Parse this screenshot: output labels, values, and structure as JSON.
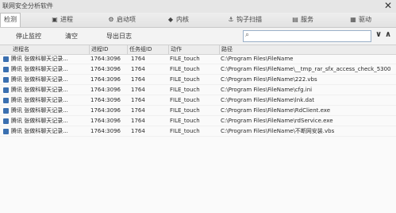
{
  "window": {
    "title": "联网安全分析软件",
    "close": "✕"
  },
  "tabs": [
    {
      "label": "检测",
      "icon": ""
    },
    {
      "label": "进程",
      "icon": "▣"
    },
    {
      "label": "启动项",
      "icon": "⚙"
    },
    {
      "label": "内核",
      "icon": "◆"
    },
    {
      "label": "钩子扫描",
      "icon": "⚓"
    },
    {
      "label": "服务",
      "icon": "▤"
    },
    {
      "label": "驱动",
      "icon": "▦"
    }
  ],
  "toolbar": {
    "stop": "停止监控",
    "clear": "清空",
    "export": "导出日志"
  },
  "search": {
    "value": "",
    "icon": "search-icon"
  },
  "table": {
    "columns": [
      "进程名",
      "进程ID",
      "任务组ID",
      "动作",
      "路径"
    ],
    "rows": [
      {
        "name": "腾讯 张做科聊天记录...",
        "pid": "1764:3096",
        "tgid": "1764",
        "action": "FILE_touch",
        "path": "C:\\Program Files\\FileName"
      },
      {
        "name": "腾讯 张做科聊天记录...",
        "pid": "1764:3096",
        "tgid": "1764",
        "action": "FILE_touch",
        "path": "C:\\Program Files\\FileName\\__tmp_rar_sfx_access_check_5300"
      },
      {
        "name": "腾讯 张做科聊天记录...",
        "pid": "1764:3096",
        "tgid": "1764",
        "action": "FILE_touch",
        "path": "C:\\Program Files\\FileName\\222.vbs"
      },
      {
        "name": "腾讯 张做科聊天记录...",
        "pid": "1764:3096",
        "tgid": "1764",
        "action": "FILE_touch",
        "path": "C:\\Program Files\\FileName\\cfg.ini"
      },
      {
        "name": "腾讯 张做科聊天记录...",
        "pid": "1764:3096",
        "tgid": "1764",
        "action": "FILE_touch",
        "path": "C:\\Program Files\\FileName\\lnk.dat"
      },
      {
        "name": "腾讯 张做科聊天记录...",
        "pid": "1764:3096",
        "tgid": "1764",
        "action": "FILE_touch",
        "path": "C:\\Program Files\\FileName\\RdClient.exe"
      },
      {
        "name": "腾讯 张做科聊天记录...",
        "pid": "1764:3096",
        "tgid": "1764",
        "action": "FILE_touch",
        "path": "C:\\Program Files\\FileName\\rdService.exe"
      },
      {
        "name": "腾讯 张做科聊天记录...",
        "pid": "1764:3096",
        "tgid": "1764",
        "action": "FILE_touch",
        "path": "C:\\Program Files\\FileName\\不断网安装.vbs"
      }
    ]
  }
}
